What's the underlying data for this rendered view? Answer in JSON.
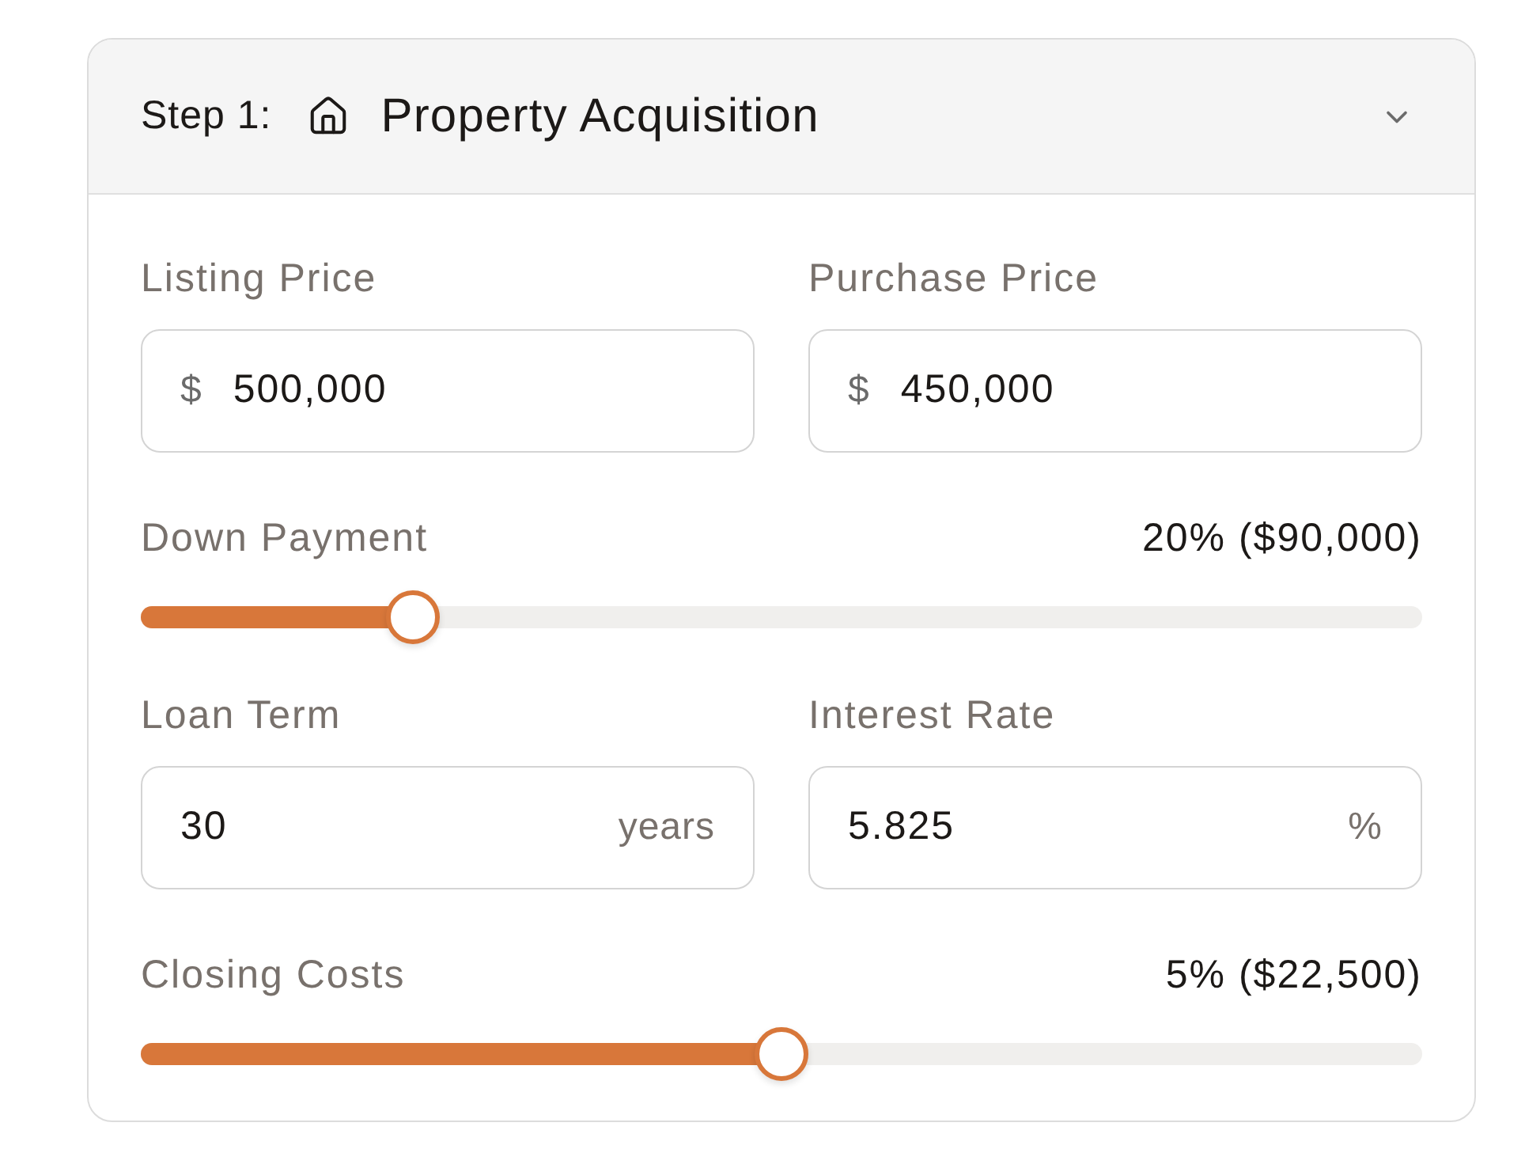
{
  "section": {
    "step_label": "Step 1:",
    "title": "Property Acquisition",
    "expanded": true
  },
  "rows": [
    {
      "kind": "fields",
      "fields": [
        {
          "label": "Listing Price",
          "prefix": "$",
          "value": "500,000"
        },
        {
          "label": "Purchase Price",
          "prefix": "$",
          "value": "450,000"
        }
      ]
    },
    {
      "kind": "slider",
      "label": "Down Payment",
      "reading": "20% ($90,000)",
      "level": 0.2
    },
    {
      "kind": "fields",
      "fields": [
        {
          "label": "Loan Term",
          "value": "30",
          "suffix": "years"
        },
        {
          "label": "Interest Rate",
          "value": "5.825",
          "suffix": "%"
        }
      ]
    },
    {
      "kind": "slider",
      "label": "Closing Costs",
      "reading": "5% ($22,500)",
      "level": 0.5
    }
  ]
}
